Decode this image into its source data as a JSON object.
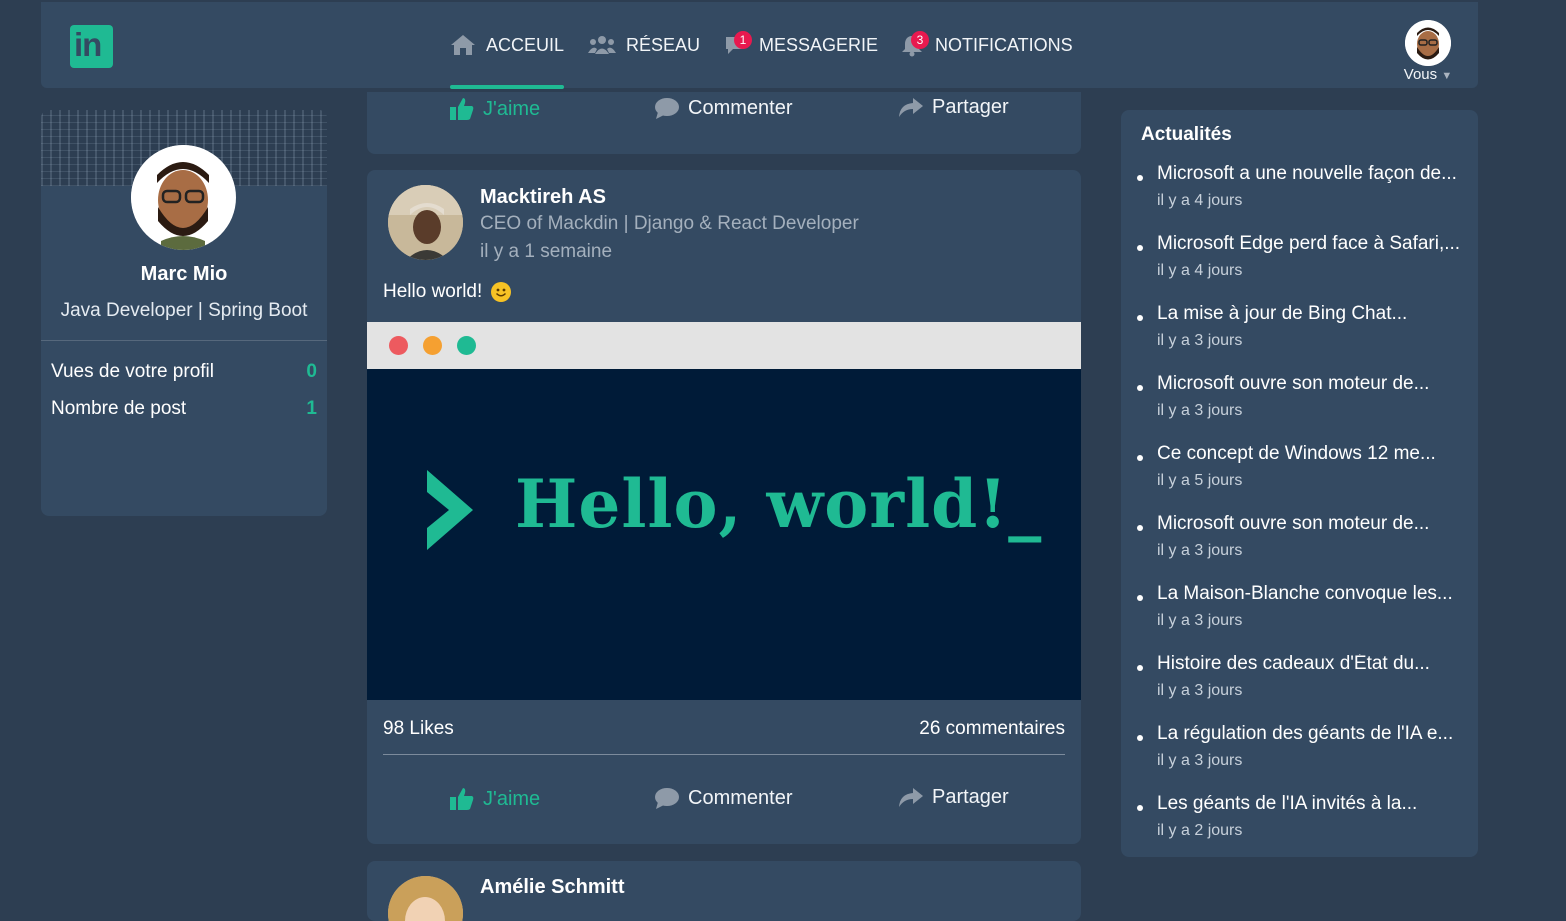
{
  "brand": {
    "logo_text": "in"
  },
  "nav": {
    "items": [
      {
        "label": "ACCEUIL",
        "icon": "home-icon",
        "active": true
      },
      {
        "label": "RÉSEAU",
        "icon": "network-icon"
      },
      {
        "label": "MESSAGERIE",
        "icon": "message-icon",
        "badge": "1"
      },
      {
        "label": "NOTIFICATIONS",
        "icon": "bell-icon",
        "badge": "3"
      }
    ],
    "me_label": "Vous"
  },
  "profile": {
    "name": "Marc Mio",
    "title": "Java Developer | Spring Boot",
    "stats": [
      {
        "label": "Vues de votre profil",
        "value": "0"
      },
      {
        "label": "Nombre de post",
        "value": "1"
      }
    ]
  },
  "post_actions": {
    "like": "J'aime",
    "comment": "Commenter",
    "share": "Partager"
  },
  "post": {
    "author": "Macktireh AS",
    "headline": "CEO of Mackdin | Django & React Developer",
    "time": "il y a 1 semaine",
    "text": "Hello world!",
    "image_text": "Hello, world!_",
    "likes": "98 Likes",
    "comments": "26 commentaires"
  },
  "next_post": {
    "author": "Amélie Schmitt"
  },
  "news": {
    "heading": "Actualités",
    "items": [
      {
        "title": "Microsoft a une nouvelle façon de...",
        "time": "il y a 4 jours"
      },
      {
        "title": "Microsoft Edge perd face à Safari,...",
        "time": "il y a 4 jours"
      },
      {
        "title": "La mise à jour de Bing Chat...",
        "time": "il y a 3 jours"
      },
      {
        "title": "Microsoft ouvre son moteur de...",
        "time": "il y a 3 jours"
      },
      {
        "title": "Ce concept de Windows 12 me...",
        "time": "il y a 5 jours"
      },
      {
        "title": "Microsoft ouvre son moteur de...",
        "time": "il y a 3 jours"
      },
      {
        "title": "La Maison-Blanche convoque les...",
        "time": "il y a 3 jours"
      },
      {
        "title": "Histoire des cadeaux d'État du...",
        "time": "il y a 3 jours"
      },
      {
        "title": "La régulation des géants de l'IA e...",
        "time": "il y a 3 jours"
      },
      {
        "title": "Les géants de l'IA invités à la...",
        "time": "il y a 2 jours"
      }
    ]
  },
  "colors": {
    "accent": "#1fba93",
    "background": "#2d3e52",
    "card": "#344a62",
    "badge": "#e8194f"
  }
}
